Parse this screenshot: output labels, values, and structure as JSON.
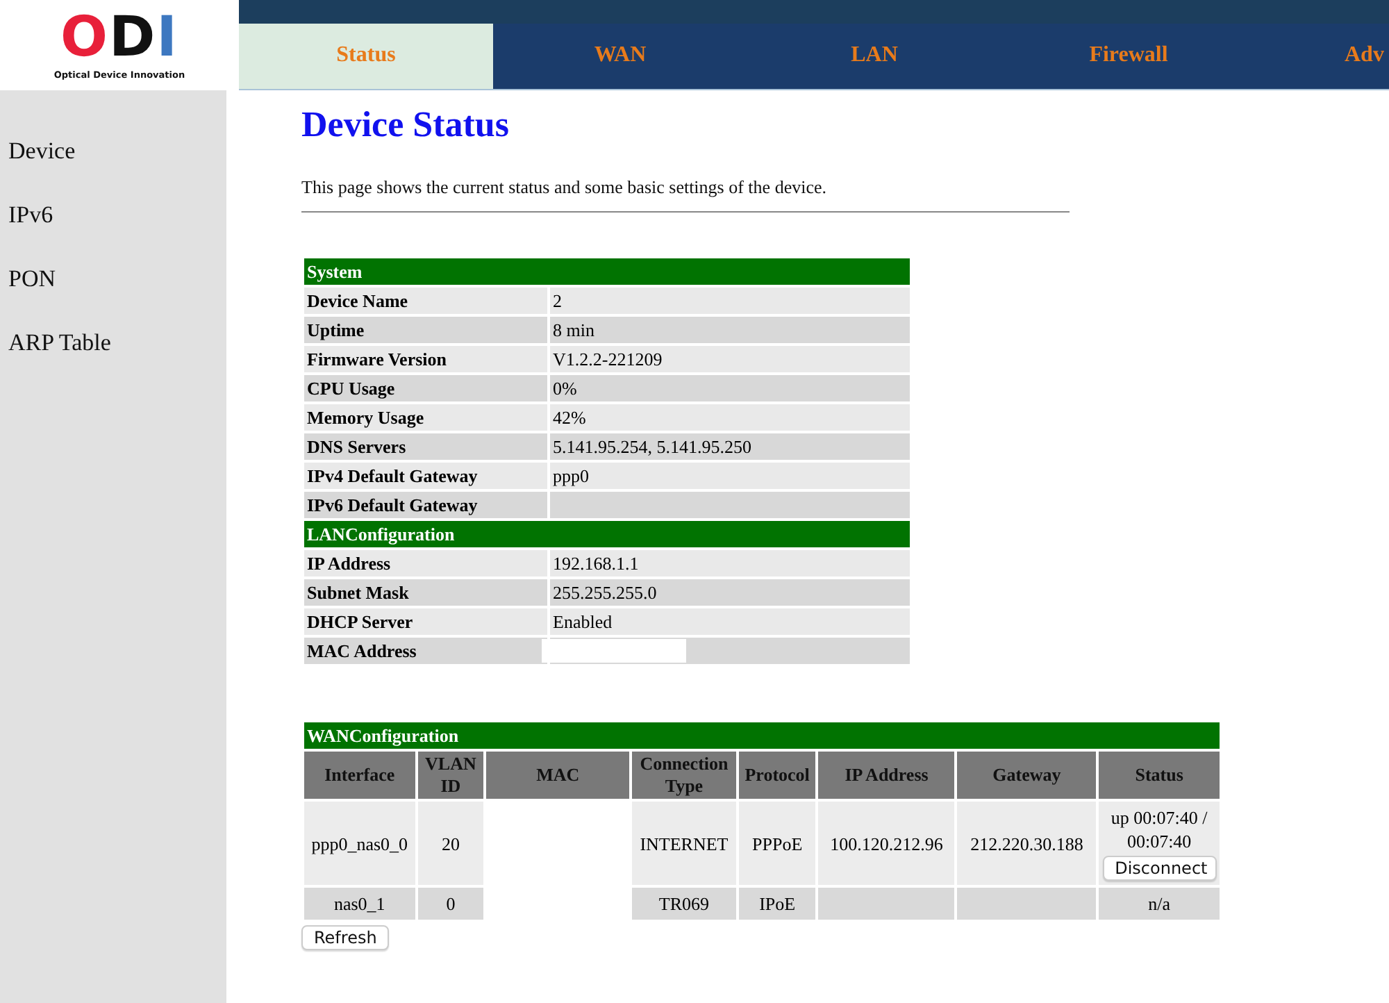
{
  "logo": {
    "mark": "ODI",
    "tagline": "Optical Device Innovation"
  },
  "tabs": [
    {
      "label": "Status",
      "selected": true
    },
    {
      "label": "WAN",
      "selected": false
    },
    {
      "label": "LAN",
      "selected": false
    },
    {
      "label": "Firewall",
      "selected": false
    },
    {
      "label": "Adv",
      "selected": false
    }
  ],
  "sidebar": {
    "items": [
      "Device",
      "IPv6",
      "PON",
      "ARP Table"
    ]
  },
  "title": "Device Status",
  "description": "This page shows the current status and some basic settings of the device.",
  "info_sections": [
    {
      "title": "System",
      "rows": [
        {
          "label": "Device Name",
          "value": "2"
        },
        {
          "label": "Uptime",
          "value": "8 min"
        },
        {
          "label": "Firmware Version",
          "value": "V1.2.2-221209"
        },
        {
          "label": "CPU Usage",
          "value": "0%"
        },
        {
          "label": "Memory Usage",
          "value": "42%"
        },
        {
          "label": "DNS Servers",
          "value": "5.141.95.254, 5.141.95.250"
        },
        {
          "label": "IPv4 Default Gateway",
          "value": "ppp0"
        },
        {
          "label": "IPv6 Default Gateway"
        }
      ]
    },
    {
      "title": "LANConfiguration",
      "rows": [
        {
          "label": "IP Address",
          "value": "192.168.1.1"
        },
        {
          "label": "Subnet Mask",
          "value": "255.255.255.0"
        },
        {
          "label": "DHCP Server",
          "value": "Enabled"
        },
        {
          "label": "MAC Address",
          "redacted": true
        }
      ]
    }
  ],
  "wan": {
    "title": "WANConfiguration",
    "columns": [
      "Interface",
      "VLAN ID",
      "MAC",
      "Connection Type",
      "Protocol",
      "IP Address",
      "Gateway",
      "Status"
    ],
    "rows": [
      {
        "interface": "ppp0_nas0_0",
        "vlan": "20",
        "connection_type": "INTERNET",
        "protocol": "PPPoE",
        "ip_address": "100.120.212.96",
        "gateway": "212.220.30.188",
        "status": "up 00:07:40 / 00:07:40",
        "action": "Disconnect"
      },
      {
        "interface": "nas0_1",
        "vlan": "0",
        "connection_type": "TR069",
        "protocol": "IPoE",
        "status": "n/a"
      }
    ]
  },
  "refresh_button": "Refresh"
}
